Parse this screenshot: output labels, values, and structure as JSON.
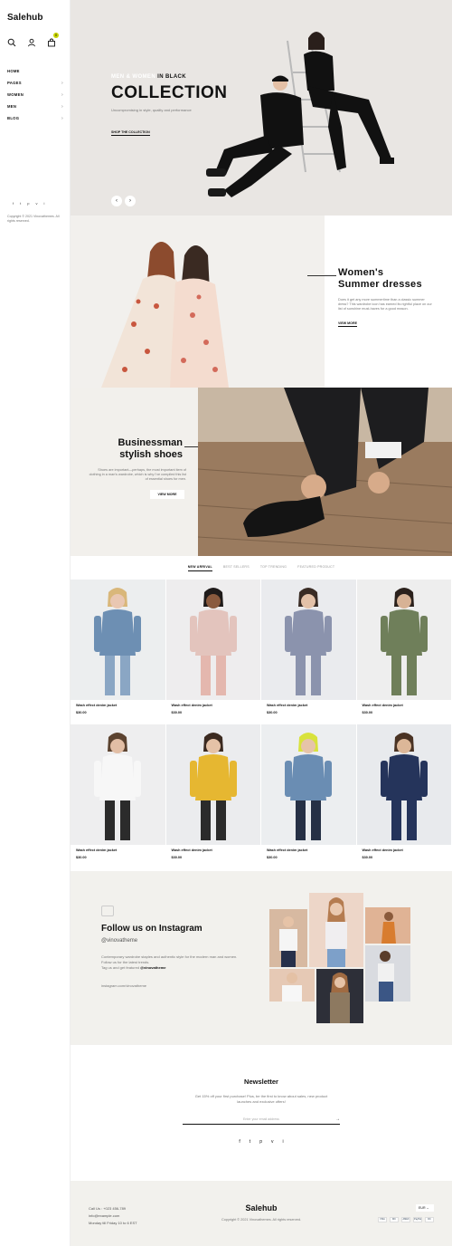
{
  "sidebar": {
    "logo": "Salehub",
    "cart_count": "0",
    "nav": [
      {
        "label": "HOME",
        "has_children": false
      },
      {
        "label": "PAGES",
        "has_children": true
      },
      {
        "label": "WOMEN",
        "has_children": true
      },
      {
        "label": "MEN",
        "has_children": true
      },
      {
        "label": "BLOG",
        "has_children": true
      }
    ],
    "socials": [
      "f",
      "t",
      "p",
      "v",
      "i"
    ],
    "copyright": "Copyright © 2021 Vinovathemes. All rights reserved."
  },
  "hero": {
    "subtitle_part1": "MEN & WOMEN",
    "subtitle_part2": "IN BLACK",
    "title": "COLLECTION",
    "description": "Uncompromising in style, quality and performance",
    "link": "SHOP THE COLLECTION",
    "prev": "‹",
    "next": "›"
  },
  "women": {
    "title_line1": "Women's",
    "title_line2": "Summer dresses",
    "description": "Does it get any more summertime than a classic summer dress? This wardrobe icon has earned its rightful place on our list of sunshine must-haves for a good reason.",
    "link": "VIEW MORE"
  },
  "shoes": {
    "title_line1": "Businessman",
    "title_line2": "stylish shoes",
    "description": "Shoes are important—perhaps, the most important item of clothing in a man's wardrobe, which is why I've compiled this list of essential shoes for men.",
    "button": "VIEW MORE"
  },
  "tabs": [
    "NEW ARRIVAL",
    "BEST SELLERS",
    "TOP TRENDING",
    "FEATURED PRODUCT"
  ],
  "products": [
    {
      "name": "Wash effect denim jacket",
      "price": "$30.00",
      "bg": "#eceeef",
      "top": "#6d8fb3",
      "bottom": "#8aa6c4",
      "skin": "#e9c7b2",
      "hair": "#d9b77a"
    },
    {
      "name": "Wash effect denim jacket",
      "price": "$30.00",
      "bg": "#eeedee",
      "top": "#e3c4bd",
      "bottom": "#e4b7ae",
      "skin": "#8a5a3e",
      "hair": "#1f1b1a"
    },
    {
      "name": "Wash effect denim jacket",
      "price": "$30.00",
      "bg": "#eaebee",
      "top": "#8b93ad",
      "bottom": "#8b93ad",
      "skin": "#e3c1a8",
      "hair": "#3a2c25"
    },
    {
      "name": "Wash effect denim jacket",
      "price": "$30.00",
      "bg": "#eeeeee",
      "top": "#6f7f5a",
      "bottom": "#6f7f5a",
      "skin": "#d7b295",
      "hair": "#2b211c"
    },
    {
      "name": "Wash effect denim jacket",
      "price": "$30.00",
      "bg": "#eeeeef",
      "top": "#f7f7f7",
      "bottom": "#2b2b2b",
      "skin": "#e2bea5",
      "hair": "#5c4330"
    },
    {
      "name": "Wash effect denim jacket",
      "price": "$30.00",
      "bg": "#ebecee",
      "top": "#e6b731",
      "bottom": "#2b2b2b",
      "skin": "#e5c2a7",
      "hair": "#3b2a20"
    },
    {
      "name": "Wash effect denim jacket",
      "price": "$30.00",
      "bg": "#eceef0",
      "top": "#6a8db3",
      "bottom": "#263045",
      "skin": "#e6c4a9",
      "hair": "#d8e23c"
    },
    {
      "name": "Wash effect denim jacket",
      "price": "$30.00",
      "bg": "#e8eaed",
      "top": "#25345b",
      "bottom": "#25345b",
      "skin": "#dcb798",
      "hair": "#4a3324"
    }
  ],
  "instagram": {
    "title": "Follow us on Instagram",
    "handle": "@vinovatheme",
    "description": "Contemporary wardrobe staples and authentic style for the modern man and women. Follow us for the latest trends.",
    "tag_text": "Tag us and get featured",
    "tag_handle": "@vinovatheme",
    "url": "instagram.com/vinovatheme"
  },
  "newsletter": {
    "title": "Newsletter",
    "description": "Get 15% off your first purchase! Plus, be the first to know about sales, new product launches and exclusive offers!",
    "placeholder": "Enter your email address",
    "submit": "→",
    "socials": [
      "f",
      "t",
      "p",
      "v",
      "i"
    ]
  },
  "footer": {
    "phone": "Call Us : +023 456-789",
    "email": "info@example.com",
    "hours": "Monday till Friday 10 to 6 EST",
    "logo": "Salehub",
    "copyright": "Copyright © 2021 Vinovathemes. All rights reserved.",
    "currency": "EUR ⌄",
    "payments": [
      "VISA",
      "MC",
      "AMEX",
      "PayPal",
      "DC"
    ]
  },
  "colors": {
    "hero_bg": "#e9e6e3",
    "section_bg": "#f2f1ed",
    "accent": "#c7d400",
    "text": "#111111"
  }
}
